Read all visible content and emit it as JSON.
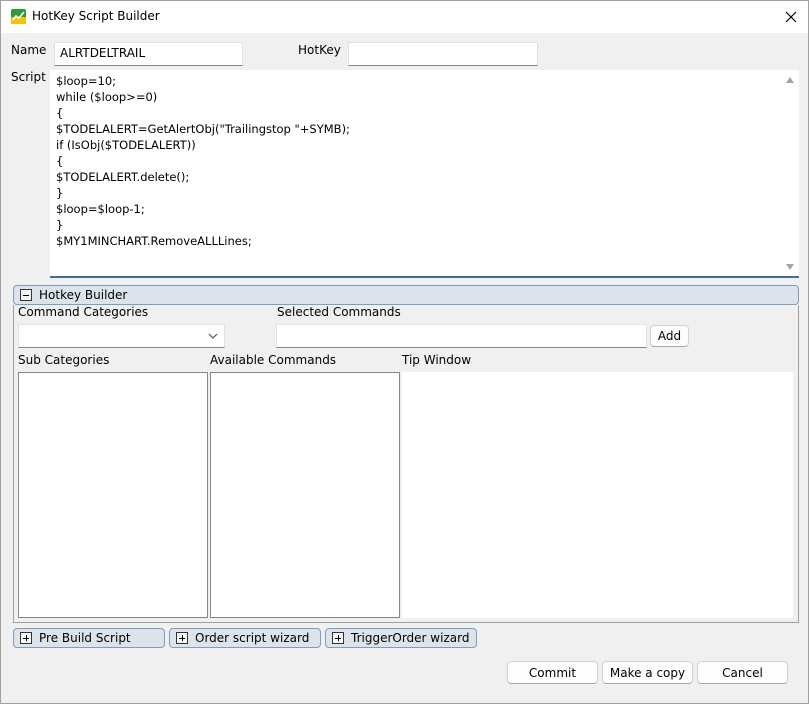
{
  "window": {
    "title": "HotKey Script Builder",
    "close_icon": "close-icon"
  },
  "form": {
    "name_label": "Name",
    "name_value": "ALRTDELTRAIL",
    "hotkey_label": "HotKey",
    "hotkey_value": "",
    "script_label": "Script",
    "script_text": "$loop=10;\nwhile ($loop>=0)\n{\n$TODELALERT=GetAlertObj(\"Trailingstop \"+SYMB);\nif (IsObj($TODELALERT))\n{\n$TODELALERT.delete();\n}\n$loop=$loop-1;\n}\n$MY1MINCHART.RemoveALLLines;"
  },
  "hotkey_builder": {
    "header": "Hotkey Builder",
    "expander_state": "expanded",
    "command_categories_label": "Command Categories",
    "command_categories_value": "",
    "selected_commands_label": "Selected Commands",
    "selected_commands_value": "",
    "add_label": "Add",
    "sub_categories_label": "Sub Categories",
    "available_commands_label": "Available Commands",
    "tip_window_label": "Tip Window"
  },
  "sections": [
    {
      "label": "Pre Build Script",
      "expander_state": "collapsed"
    },
    {
      "label": "Order script wizard",
      "expander_state": "collapsed"
    },
    {
      "label": "TriggerOrder wizard",
      "expander_state": "collapsed"
    }
  ],
  "footer": {
    "commit_label": "Commit",
    "copy_label": "Make a copy",
    "cancel_label": "Cancel"
  },
  "colors": {
    "accent": "#3f6f9f",
    "group_header_bg": "#dde3ea",
    "window_bg": "#f0f0f0"
  }
}
